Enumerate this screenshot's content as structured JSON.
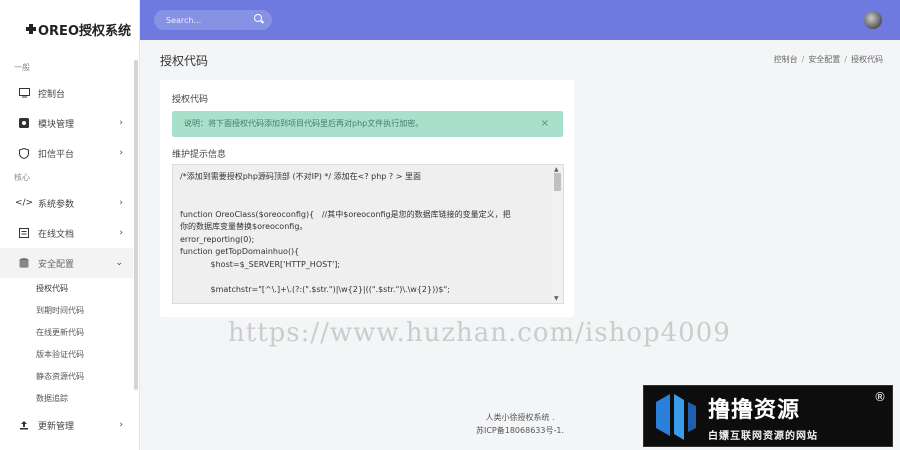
{
  "app": {
    "brand": "OREO授权系统"
  },
  "header": {
    "search_placeholder": "Search..."
  },
  "sidebar": {
    "section_general": "一般",
    "items": [
      {
        "label": "控制台",
        "icon": "monitor-icon"
      },
      {
        "label": "模块管理",
        "icon": "module-icon"
      },
      {
        "label": "扣信平台",
        "icon": "shield-icon"
      }
    ],
    "section_core": "核心",
    "core_items": [
      {
        "label": "系统参数",
        "icon": "code-icon"
      },
      {
        "label": "在线文档",
        "icon": "document-icon"
      },
      {
        "label": "安全配置",
        "icon": "database-icon"
      }
    ],
    "sub_items": [
      "授权代码",
      "到期时间代码",
      "在线更新代码",
      "版本验证代码",
      "静态资源代码",
      "数据追踪"
    ],
    "more_item": {
      "label": "更新管理",
      "icon": "upload-icon"
    }
  },
  "page": {
    "title": "授权代码",
    "breadcrumb": [
      "控制台",
      "安全配置",
      "授权代码"
    ]
  },
  "card": {
    "label": "授权代码",
    "alert_text": "说明：将下面授权代码添加到项目代码里后再对php文件执行加密。",
    "alert_close": "×",
    "code_label": "维护提示信息",
    "code_lines": [
      "/*添加到需要授权php源码顶部 (不对IP) */ 添加在<? php ? > 里面",
      "",
      "",
      "function OreoClass($oreoconfig){   //其中$oreoconfig是您的数据库链接的变量定义，把",
      "你的数据库变量替换$oreoconfig。",
      "error_reporting(0);",
      "function getTopDomainhuo(){",
      "            $host=$_SERVER['HTTP_HOST'];",
      "",
      "            $matchstr=\"[^\\.]+\\.(?:(\".$str.\")|\\w{2}|((\".$str.\")\\.\\w{2}))$\";"
    ]
  },
  "footer": {
    "line1": "人类小徐授权系统 .",
    "line2": "苏ICP备18068633号-1."
  },
  "watermark": "https://www.huzhan.com/ishop4009",
  "badge": {
    "title": "撸撸资源",
    "reg": "®",
    "subtitle": "白嫖互联网资源的网站"
  }
}
